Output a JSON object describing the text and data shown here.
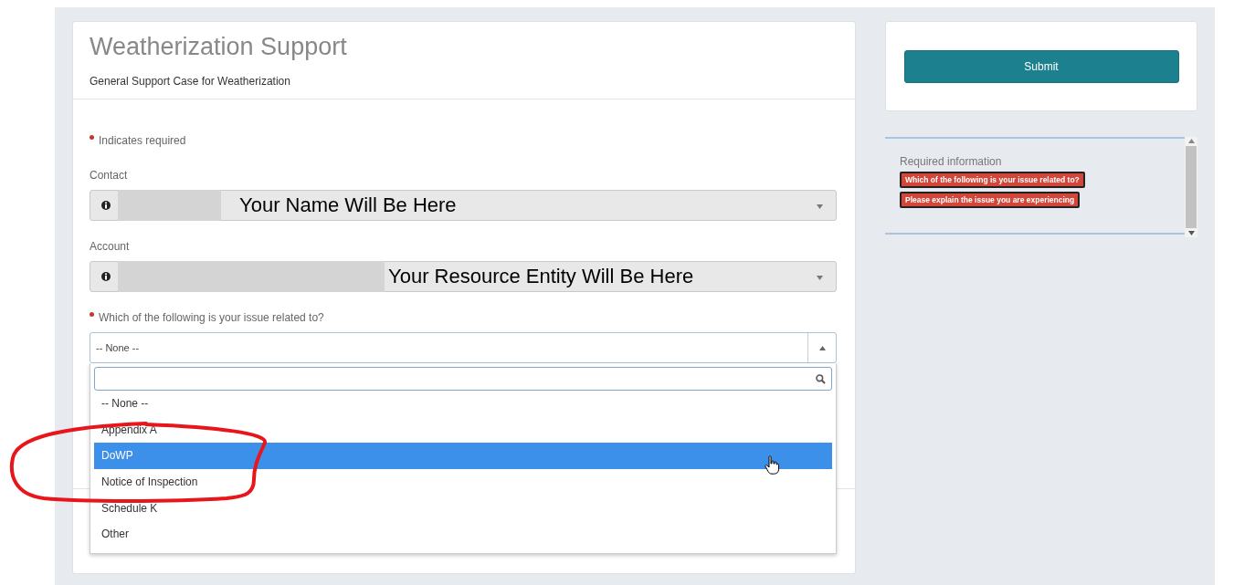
{
  "form": {
    "title": "Weatherization Support",
    "subtitle": "General Support Case for Weatherization",
    "required_note": "Indicates required",
    "fields": [
      {
        "kind": "lookup",
        "label": "Contact",
        "required": false,
        "value": "Your Name Will Be Here"
      },
      {
        "kind": "lookup",
        "label": "Account",
        "required": false,
        "value": "Your Resource Entity Will Be Here"
      },
      {
        "kind": "picklist",
        "label": "Which of the following is your issue related to?",
        "required": true,
        "value": "-- None --",
        "expanded": true,
        "options": [
          {
            "label": "-- None --",
            "highlighted": false
          },
          {
            "label": "Appendix A",
            "highlighted": false
          },
          {
            "label": "DoWP",
            "highlighted": true
          },
          {
            "label": "Notice of Inspection",
            "highlighted": false
          },
          {
            "label": "Schedule K",
            "highlighted": false
          },
          {
            "label": "Other",
            "highlighted": false
          }
        ]
      }
    ]
  },
  "sidebar": {
    "submit_label": "Submit",
    "required_info": {
      "heading": "Required information",
      "items": [
        "Which of the following is your issue related to?",
        "Please explain the issue you are experiencing"
      ]
    }
  }
}
